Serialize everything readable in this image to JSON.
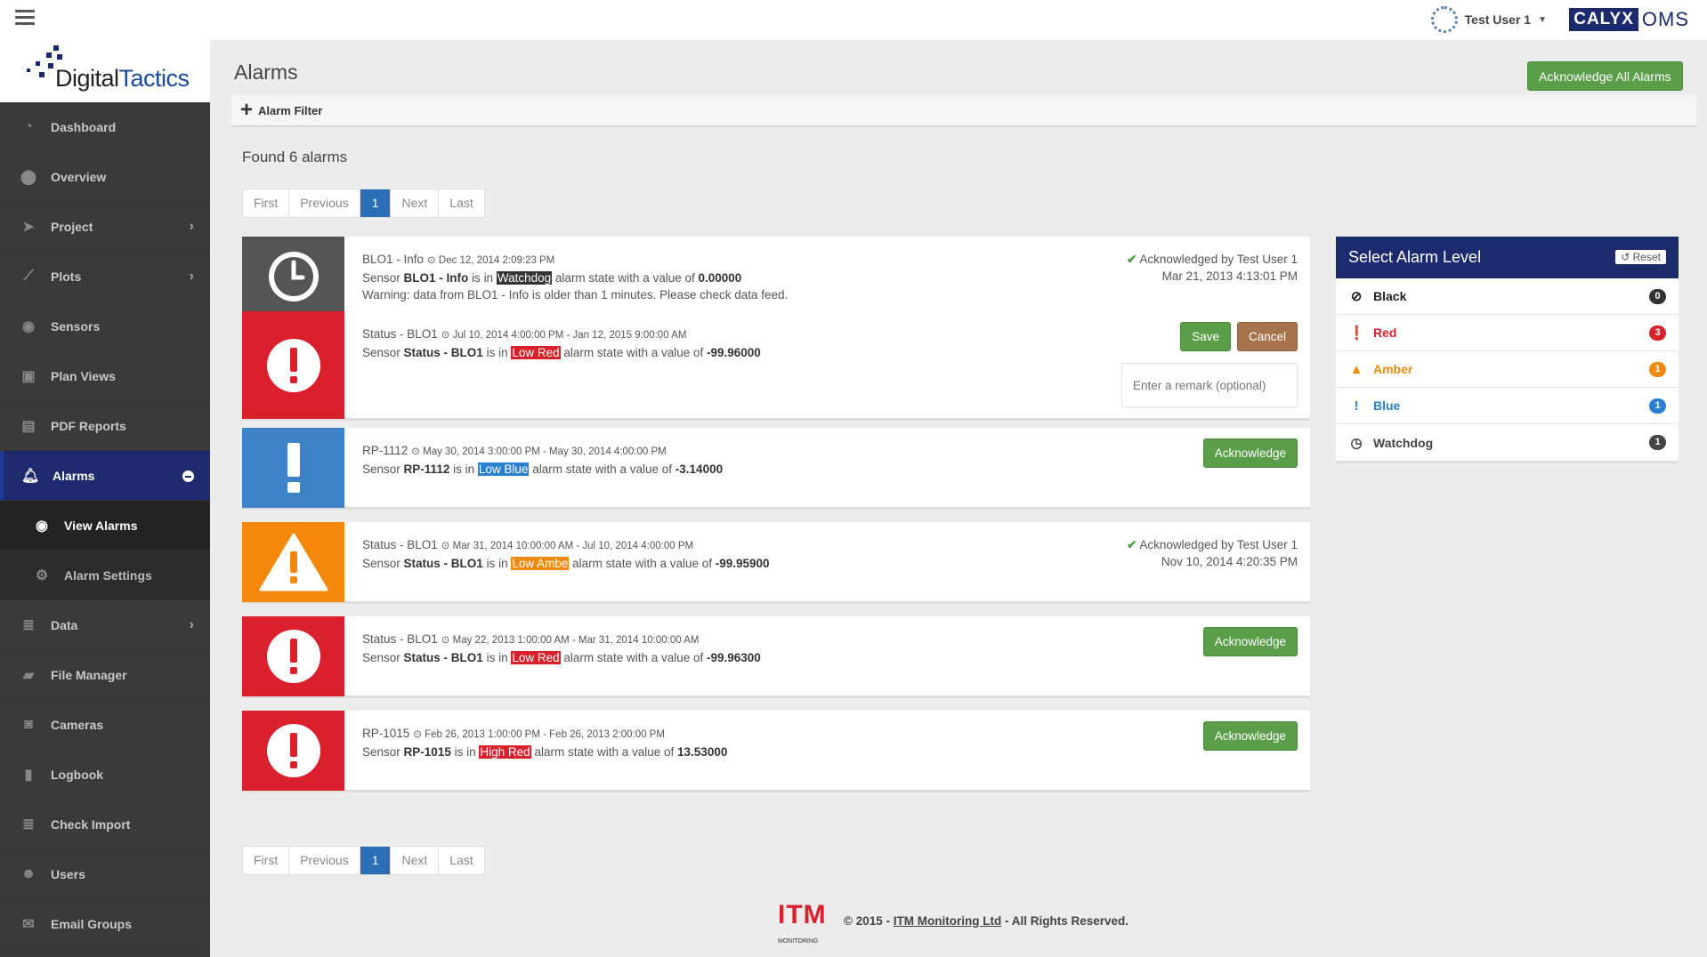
{
  "topbar": {
    "user_name": "Test User 1",
    "calyx_brand": "CALYX",
    "calyx_product": "OMS"
  },
  "logo": {
    "part1": "Digital",
    "part2": "Tactics"
  },
  "sidebar": {
    "items": [
      {
        "label": "Dashboard",
        "icon": "dashboard-icon"
      },
      {
        "label": "Overview",
        "icon": "map-marker-icon"
      },
      {
        "label": "Project",
        "icon": "paper-plane-icon"
      },
      {
        "label": "Plots",
        "icon": "line-chart-icon"
      },
      {
        "label": "Sensors",
        "icon": "sensor-icon"
      },
      {
        "label": "Plan Views",
        "icon": "image-icon"
      },
      {
        "label": "PDF Reports",
        "icon": "pdf-icon"
      },
      {
        "label": "Alarms",
        "icon": "bell-icon"
      },
      {
        "label": "Data",
        "icon": "database-icon"
      },
      {
        "label": "File Manager",
        "icon": "folder-icon"
      },
      {
        "label": "Cameras",
        "icon": "camera-icon"
      },
      {
        "label": "Logbook",
        "icon": "book-icon"
      },
      {
        "label": "Check Import",
        "icon": "database-icon"
      },
      {
        "label": "Users",
        "icon": "users-icon"
      },
      {
        "label": "Email Groups",
        "icon": "envelope-icon"
      }
    ],
    "sub_items": [
      {
        "label": "View Alarms",
        "icon": "eye-icon"
      },
      {
        "label": "Alarm Settings",
        "icon": "cogs-icon"
      }
    ]
  },
  "main": {
    "title": "Alarms",
    "ack_all_label": "Acknowledge All Alarms",
    "filter_label": "Alarm Filter",
    "found_text": "Found 6 alarms",
    "pager": {
      "first": "First",
      "previous": "Previous",
      "current": "1",
      "next": "Next",
      "last": "Last"
    }
  },
  "alarms": [
    {
      "level": "watchdog",
      "icon": "clock-icon",
      "name": "BLO1 - Info",
      "time": "Dec 12, 2014 2:09:23 PM",
      "sensor": "BLO1 - Info",
      "state": "Watchdog",
      "value": "0.00000",
      "warning": "Warning: data from BLO1 - Info is older than 1 minutes. Please check data feed.",
      "ack_by": "Acknowledged by Test User 1",
      "ack_time": "Mar 21, 2013 4:13:01 PM"
    },
    {
      "level": "red",
      "icon": "exclamation-circle-icon",
      "name": "Status - BLO1",
      "time": "Jul 10, 2014 4:00:00 PM - Jan 12, 2015 9:00:00 AM",
      "sensor": "Status - BLO1",
      "state": "Low Red",
      "value": "-99.96000",
      "save_label": "Save",
      "cancel_label": "Cancel",
      "remark_placeholder": "Enter a remark (optional)"
    },
    {
      "level": "blue",
      "icon": "exclamation-icon",
      "name": "RP-1112",
      "time": "May 30, 2014 3:00:00 PM - May 30, 2014 4:00:00 PM",
      "sensor": "RP-1112",
      "state": "Low Blue",
      "value": "-3.14000",
      "ack_label": "Acknowledge"
    },
    {
      "level": "amber",
      "icon": "warning-triangle-icon",
      "name": "Status - BLO1",
      "time": "Mar 31, 2014 10:00:00 AM - Jul 10, 2014 4:00:00 PM",
      "sensor": "Status - BLO1",
      "state": "Low Ambe",
      "value": "-99.95900",
      "ack_by": "Acknowledged by Test User 1",
      "ack_time": "Nov 10, 2014 4:20:35 PM"
    },
    {
      "level": "red",
      "icon": "exclamation-circle-icon",
      "name": "Status - BLO1",
      "time": "May 22, 2013 1:00:00 AM - Mar 31, 2014 10:00:00 AM",
      "sensor": "Status - BLO1",
      "state": "Low Red",
      "value": "-99.96300",
      "ack_label": "Acknowledge"
    },
    {
      "level": "red",
      "icon": "exclamation-circle-icon",
      "name": "RP-1015",
      "time": "Feb 26, 2013 1:00:00 PM - Feb 26, 2013 2:00:00 PM",
      "sensor": "RP-1015",
      "state": "High Red",
      "value": "13.53000",
      "ack_label": "Acknowledge"
    }
  ],
  "sentence": {
    "sensor_word": "Sensor",
    "is_in": "is in",
    "alarm_state": "alarm state with a value of"
  },
  "level_panel": {
    "title": "Select Alarm Level",
    "reset_label": "Reset",
    "levels": [
      {
        "label": "Black",
        "count": "0",
        "color": "#222222",
        "icon": "ban-icon"
      },
      {
        "label": "Red",
        "count": "3",
        "color": "#d9212c",
        "icon": "exclamation-circle-icon"
      },
      {
        "label": "Amber",
        "count": "1",
        "color": "#f08a0c",
        "icon": "warning-triangle-icon"
      },
      {
        "label": "Blue",
        "count": "1",
        "color": "#2a7fd0",
        "icon": "exclamation-icon"
      },
      {
        "label": "Watchdog",
        "count": "1",
        "color": "#444444",
        "icon": "clock-icon"
      }
    ]
  },
  "footer": {
    "itm": "ITM",
    "itm_sub": "MONITORING",
    "copyright_prefix": "© 2015 -",
    "company": "ITM Monitoring Ltd",
    "copyright_suffix": "- All Rights Reserved."
  }
}
